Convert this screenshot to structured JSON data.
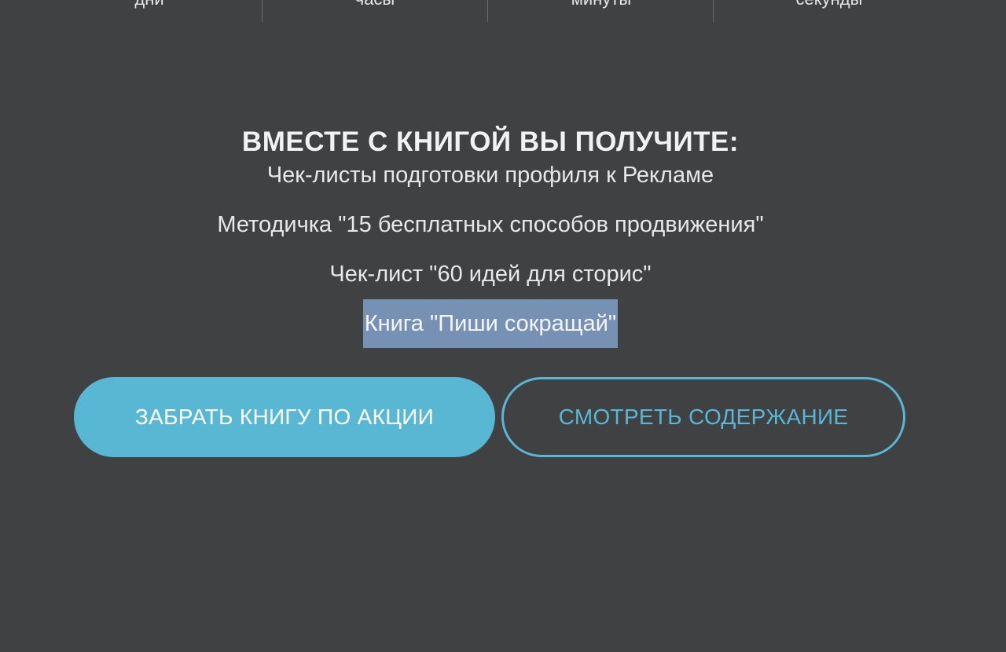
{
  "countdown": {
    "units": [
      "дни",
      "часы",
      "минуты",
      "секунды"
    ]
  },
  "offer": {
    "title": "ВМЕСТЕ С КНИГОЙ ВЫ ПОЛУЧИТЕ:",
    "items": [
      "Чек-листы подготовки профиля к Рекламе",
      "Методичка \"15 бесплатных способов продвижения\"",
      "Чек-лист \"60 идей для сторис\"",
      "Книга \"Пиши сокращай\""
    ],
    "selected_item_index": 3
  },
  "buttons": {
    "primary_label": "ЗАБРАТЬ КНИГУ ПО АКЦИИ",
    "secondary_label": "СМОТРЕТЬ СОДЕРЖАНИЕ"
  },
  "colors": {
    "background": "#404143",
    "accent": "#58b7d3",
    "selection": "#7791b4"
  }
}
